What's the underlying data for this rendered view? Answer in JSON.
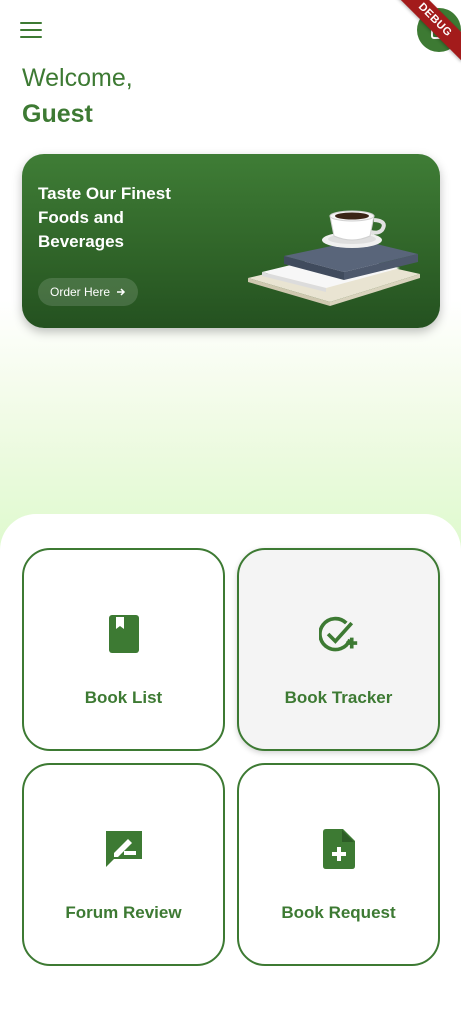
{
  "header": {
    "menu_icon": "hamburger-menu-icon",
    "profile_icon": "phone-frame-icon",
    "debug_label": "DEBUG"
  },
  "greeting": {
    "welcome": "Welcome,",
    "name": "Guest"
  },
  "banner": {
    "title": "Taste Our Finest Foods and Beverages",
    "button_label": "Order Here",
    "button_icon": "arrow-right-icon"
  },
  "menu_cards": [
    {
      "label": "Book List",
      "icon": "book-icon"
    },
    {
      "label": "Book Tracker",
      "icon": "check-circle-plus-icon"
    },
    {
      "label": "Forum Review",
      "icon": "rate-review-icon"
    },
    {
      "label": "Book Request",
      "icon": "note-add-icon"
    }
  ],
  "colors": {
    "primary": "#3d7a33",
    "banner_dark": "#245120",
    "gradient_green": "#ddf9cc",
    "debug_red": "#a31b1b"
  }
}
